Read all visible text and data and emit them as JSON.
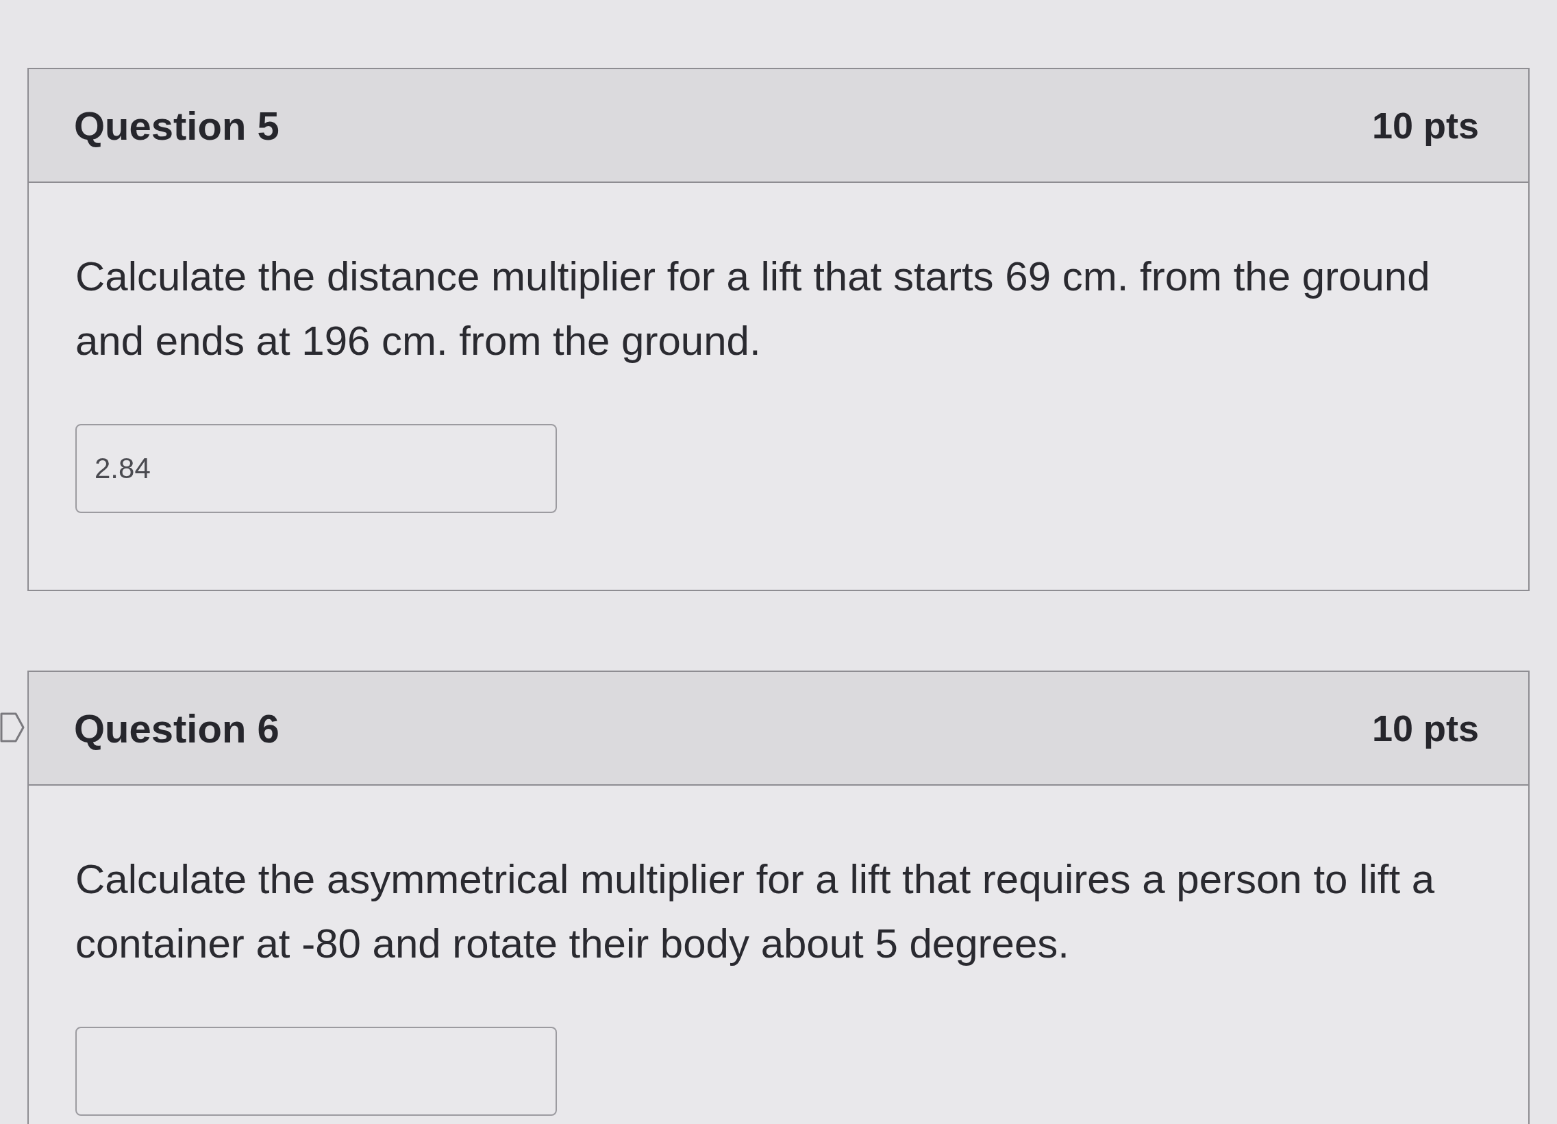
{
  "questions": [
    {
      "title": "Question 5",
      "points": "10 pts",
      "prompt": "Calculate the distance multiplier for a lift that starts 69 cm. from the ground and ends at 196 cm. from the ground.",
      "answer": "2.84"
    },
    {
      "title": "Question 6",
      "points": "10 pts",
      "flagged": false,
      "prompt": "Calculate the asymmetrical multiplier for a lift that requires a person to lift a container at -80 and rotate their body about 5 degrees."
    }
  ]
}
